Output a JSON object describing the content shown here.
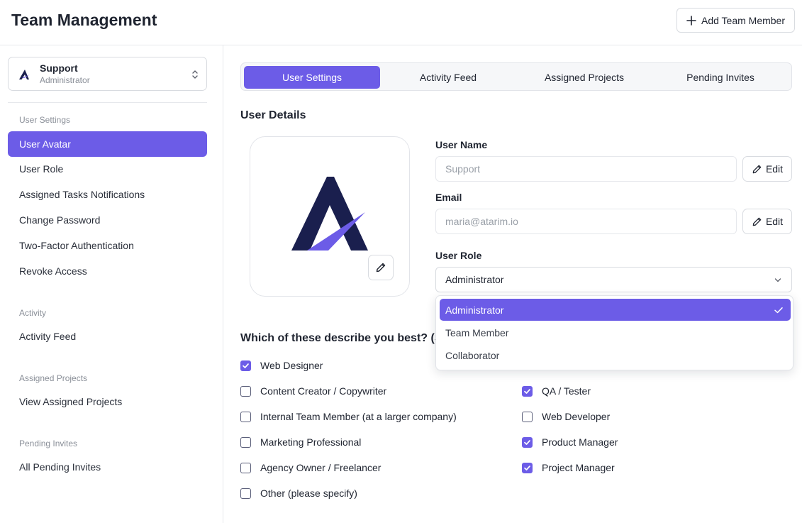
{
  "header": {
    "title": "Team Management",
    "add_button_label": "Add Team Member"
  },
  "sidebar": {
    "team": {
      "name": "Support",
      "role": "Administrator"
    },
    "sections": [
      {
        "title": "User Settings",
        "items": [
          "User Avatar",
          "User Role",
          "Assigned Tasks Notifications",
          "Change Password",
          "Two-Factor Authentication",
          "Revoke Access"
        ]
      },
      {
        "title": "Activity",
        "items": [
          "Activity Feed"
        ]
      },
      {
        "title": "Assigned Projects",
        "items": [
          "View Assigned Projects"
        ]
      },
      {
        "title": "Pending Invites",
        "items": [
          "All Pending Invites"
        ]
      }
    ],
    "active_item": "User Avatar"
  },
  "tabs": [
    "User Settings",
    "Activity Feed",
    "Assigned Projects",
    "Pending Invites"
  ],
  "active_tab": "User Settings",
  "user_details": {
    "section_title": "User Details",
    "user_name": {
      "label": "User Name",
      "placeholder": "Support",
      "edit_label": "Edit"
    },
    "email": {
      "label": "Email",
      "placeholder": "maria@atarim.io",
      "edit_label": "Edit"
    },
    "user_role": {
      "label": "User Role",
      "value": "Administrator",
      "options": [
        "Administrator",
        "Team Member",
        "Collaborator"
      ]
    }
  },
  "question": {
    "text": "Which of these describe you best? (Se",
    "options_left": [
      {
        "label": "Web Designer",
        "checked": true
      },
      {
        "label": "Content Creator / Copywriter",
        "checked": false
      },
      {
        "label": "Internal Team Member (at a larger company)",
        "checked": false
      },
      {
        "label": "Marketing Professional",
        "checked": false
      },
      {
        "label": "Agency Owner / Freelancer",
        "checked": false
      },
      {
        "label": "Other (please specify)",
        "checked": false
      }
    ],
    "options_right": [
      {
        "label": "QA / Tester",
        "checked": true
      },
      {
        "label": "Web Developer",
        "checked": false
      },
      {
        "label": "Product Manager",
        "checked": true
      },
      {
        "label": "Project Manager",
        "checked": true
      }
    ]
  },
  "colors": {
    "accent": "#6c5ce7",
    "logo_navy": "#1a1f4e"
  },
  "icons": {
    "add": "plus-icon",
    "edit": "pencil-icon",
    "select": "chevron-down-icon",
    "selected": "check-icon",
    "team_switch": "chevron-up-down-icon"
  }
}
